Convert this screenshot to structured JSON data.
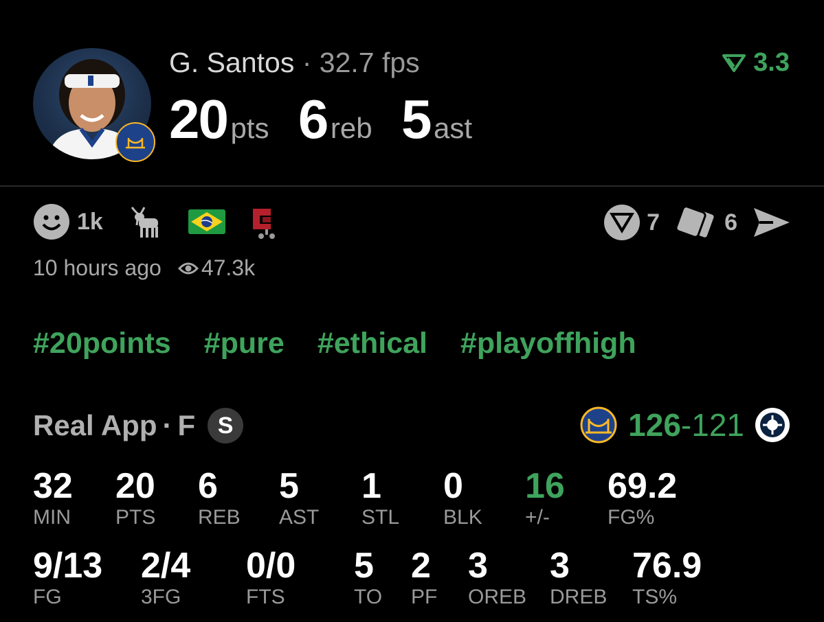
{
  "player": {
    "name": "G. Santos",
    "separator": "·",
    "fps": "32.7 fps",
    "rating": "3.3",
    "headline": [
      {
        "value": "20",
        "unit": "pts"
      },
      {
        "value": "6",
        "unit": "reb"
      },
      {
        "value": "5",
        "unit": "ast"
      }
    ]
  },
  "reactions": {
    "count": "1k",
    "icons": [
      "smile-icon",
      "goat-icon",
      "brazil-flag-icon",
      "clamp-icon"
    ]
  },
  "actions": {
    "vote_count": "7",
    "cards_count": "6"
  },
  "post": {
    "time": "10 hours ago",
    "views": "47.3k"
  },
  "tags": [
    "#20points",
    "#pure",
    "#ethical",
    "#playoffhigh"
  ],
  "game": {
    "source": "Real App",
    "dot": "·",
    "status": "F",
    "badge": "S",
    "score_winner": "126",
    "score_dash": "-",
    "score_loser": "121"
  },
  "stats_row1": [
    {
      "value": "32",
      "label": "MIN"
    },
    {
      "value": "20",
      "label": "PTS"
    },
    {
      "value": "6",
      "label": "REB"
    },
    {
      "value": "5",
      "label": "AST"
    },
    {
      "value": "1",
      "label": "STL"
    },
    {
      "value": "0",
      "label": "BLK"
    },
    {
      "value": "16",
      "label": "+/-"
    },
    {
      "value": "69.2",
      "label": "FG%"
    }
  ],
  "stats_row2": [
    {
      "value": "9/13",
      "label": "FG"
    },
    {
      "value": "2/4",
      "label": "3FG"
    },
    {
      "value": "0/0",
      "label": "FTS"
    },
    {
      "value": "5",
      "label": "TO"
    },
    {
      "value": "2",
      "label": "PF"
    },
    {
      "value": "3",
      "label": "OREB"
    },
    {
      "value": "3",
      "label": "DREB"
    },
    {
      "value": "76.9",
      "label": "TS%"
    }
  ],
  "colors": {
    "accent_green": "#3fa35c",
    "background": "#000000",
    "muted": "#9a9a9a",
    "team_blue": "#1d428a",
    "team_gold": "#fdb927"
  }
}
